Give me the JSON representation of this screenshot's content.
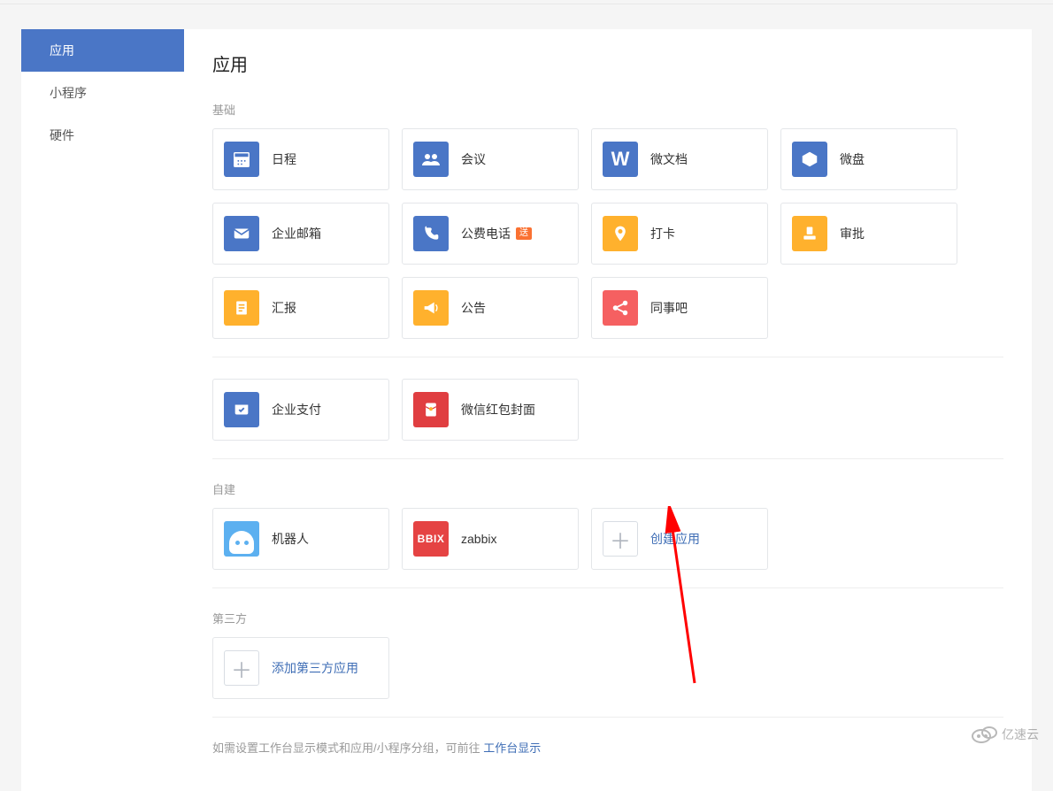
{
  "sidebar": {
    "items": [
      {
        "label": "应用",
        "active": true
      },
      {
        "label": "小程序",
        "active": false
      },
      {
        "label": "硬件",
        "active": false
      }
    ]
  },
  "page": {
    "title": "应用"
  },
  "sections": {
    "basic": {
      "label": "基础",
      "apps": {
        "calendar": "日程",
        "meeting": "会议",
        "wedoc": "微文档",
        "wedrive": "微盘",
        "mail": "企业邮箱",
        "phone": "公费电话",
        "phone_badge": "送",
        "checkin": "打卡",
        "approval": "审批",
        "report": "汇报",
        "announcement": "公告",
        "colleague": "同事吧",
        "pay": "企业支付",
        "redpacket": "微信红包封面"
      }
    },
    "custom": {
      "label": "自建",
      "apps": {
        "robot": "机器人",
        "zabbix": "zabbix",
        "create": "创建应用"
      }
    },
    "third": {
      "label": "第三方",
      "add": "添加第三方应用"
    }
  },
  "footer": {
    "prefix": "如需设置工作台显示模式和应用/小程序分组，可前往 ",
    "link": "工作台显示"
  },
  "watermark": "亿速云"
}
